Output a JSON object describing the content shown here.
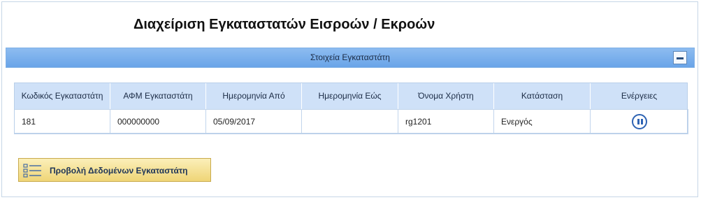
{
  "page": {
    "title": "Διαχείριση Εγκαταστατών Εισροών / Εκροών"
  },
  "panel": {
    "title": "Στοιχεία Εγκαταστάτη",
    "collapse_icon": "minus-icon"
  },
  "table": {
    "headers": [
      "Κωδικός Εγκαταστάτη",
      "ΑΦΜ Εγκαταστάτη",
      "Ημερομηνία Από",
      "Ημερομηνία Εώς",
      "Όνομα Χρήστη",
      "Κατάσταση",
      "Ενέργειες"
    ],
    "rows": [
      {
        "code": "181",
        "afm": "000000000",
        "date_from": "05/09/2017",
        "date_to": "",
        "username": "rg1201",
        "status": "Ενεργός",
        "action_icon": "pause-icon"
      }
    ]
  },
  "actions": {
    "view_data_label": "Προβολή Δεδομένων Εγκαταστάτη",
    "view_data_icon": "list-icon"
  },
  "colors": {
    "panel_header": "#69a4e8",
    "table_header": "#cfe1f8",
    "button_gold": "#efd577",
    "accent_blue": "#2e63b3"
  }
}
